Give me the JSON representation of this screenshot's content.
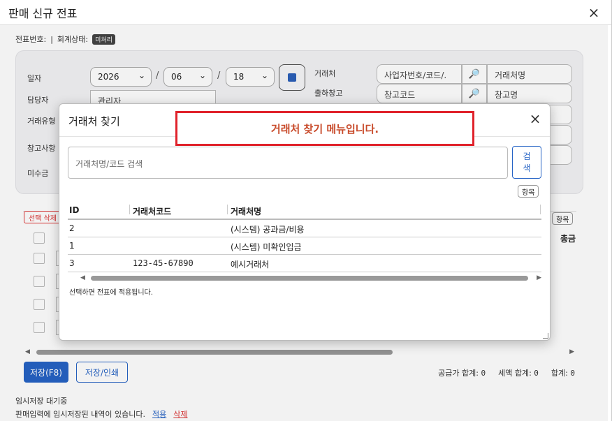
{
  "window": {
    "title": "판매 신규 전표",
    "close": "×"
  },
  "info": {
    "voucher_no_label": "전표번호:",
    "sep": "|",
    "account_status_label": "회계상태:",
    "account_status_badge": "미처리"
  },
  "form": {
    "date_label": "일자",
    "year": "2026",
    "month": "06",
    "day": "18",
    "slash": "/",
    "manager_label": "담당자",
    "manager_value": "관리자",
    "trade_type_label": "거래유형",
    "warehouse_memo_label": "창고사항",
    "receivable_label": "미수금",
    "client_label": "거래처",
    "client_code_value": "사업자번호/코드/.",
    "client_name_value": "거래처명",
    "out_wh_label": "출하창고",
    "wh_code_value": "창고코드",
    "wh_name_value": "창고명"
  },
  "grid": {
    "delete_selected": "선택 삭제",
    "items_button": "항목",
    "total_header": "총금"
  },
  "footer": {
    "save": "저장(F8)",
    "save_print": "저장/인쇄",
    "supply_total_label": "공급가 합계:",
    "supply_total_value": "0",
    "tax_total_label": "세액 합계:",
    "tax_total_value": "0",
    "sum_label": "합계:",
    "sum_value": "0",
    "temp_pending": "임시저장 대기중",
    "temp_notice": "판매입력에 임시저장된 내역이 있습니다.",
    "apply": "적용",
    "delete": "삭제"
  },
  "modal": {
    "title": "거래처 찾기",
    "close": "×",
    "annotation": "거래처 찾기 메뉴입니다.",
    "search_placeholder": "거래처명/코드 검색",
    "search_button_l1": "검",
    "search_button_l2": "색",
    "items_button": "항목",
    "columns": [
      "ID",
      "거래처코드",
      "거래처명"
    ],
    "rows": [
      {
        "id": "2",
        "code": "",
        "name": "(시스템) 공과금/비용"
      },
      {
        "id": "1",
        "code": "",
        "name": "(시스템) 미확인입금"
      },
      {
        "id": "3",
        "code": "123-45-67890",
        "name": "예시거래처"
      }
    ],
    "note": "선택하면 전표에 적용됩니다."
  },
  "colors": {
    "accent": "#2563c5",
    "danger": "#d33333",
    "annotation_border": "#e0222b",
    "annotation_text": "#c84a2a"
  }
}
